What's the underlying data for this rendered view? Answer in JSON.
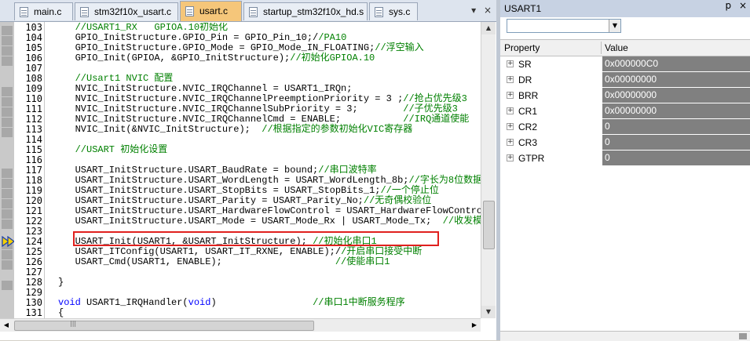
{
  "editor": {
    "tabs": [
      {
        "label": "main.c",
        "active": false
      },
      {
        "label": "stm32f10x_usart.c",
        "active": false
      },
      {
        "label": "usart.c",
        "active": true
      },
      {
        "label": "startup_stm32f10x_hd.s",
        "active": false
      },
      {
        "label": "sys.c",
        "active": false
      }
    ],
    "tab_menu_icon": "▾",
    "tab_close_icon": "×",
    "lines": [
      {
        "no": "103",
        "code": "   //USART1_RX   GPIOA.10初始化",
        "style": "cm"
      },
      {
        "no": "104",
        "code": "   GPIO_InitStructure.GPIO_Pin = GPIO_Pin_10;//PA10",
        "style": "mixed",
        "split": 46
      },
      {
        "no": "105",
        "code": "   GPIO_InitStructure.GPIO_Mode = GPIO_Mode_IN_FLOATING;//浮空输入",
        "style": "mixed",
        "split": 56
      },
      {
        "no": "106",
        "code": "   GPIO_Init(GPIOA, &GPIO_InitStructure);//初始化GPIOA.10",
        "style": "mixed",
        "split": 41
      },
      {
        "no": "107",
        "code": "",
        "style": ""
      },
      {
        "no": "108",
        "code": "   //Usart1 NVIC 配置",
        "style": "cm"
      },
      {
        "no": "109",
        "code": "   NVIC_InitStructure.NVIC_IRQChannel = USART1_IRQn;",
        "style": ""
      },
      {
        "no": "110",
        "code": "   NVIC_InitStructure.NVIC_IRQChannelPreemptionPriority = 3 ;//抢占优先级3",
        "style": "mixed",
        "split": 61
      },
      {
        "no": "111",
        "code": "   NVIC_InitStructure.NVIC_IRQChannelSubPriority = 3;        //子优先级3",
        "style": "mixed",
        "split": 61
      },
      {
        "no": "112",
        "code": "   NVIC_InitStructure.NVIC_IRQChannelCmd = ENABLE;           //IRQ通道使能",
        "style": "mixed",
        "split": 61
      },
      {
        "no": "113",
        "code": "   NVIC_Init(&NVIC_InitStructure);  //根据指定的参数初始化VIC寄存器",
        "style": "mixed",
        "split": 36
      },
      {
        "no": "114",
        "code": "",
        "style": ""
      },
      {
        "no": "115",
        "code": "   //USART 初始化设置",
        "style": "cm"
      },
      {
        "no": "116",
        "code": "",
        "style": ""
      },
      {
        "no": "117",
        "code": "   USART_InitStructure.USART_BaudRate = bound;//串口波特率",
        "style": "mixed",
        "split": 46
      },
      {
        "no": "118",
        "code": "   USART_InitStructure.USART_WordLength = USART_WordLength_8b;//字长为8位数据",
        "style": "mixed",
        "split": 62
      },
      {
        "no": "119",
        "code": "   USART_InitStructure.USART_StopBits = USART_StopBits_1;//一个停止位",
        "style": "mixed",
        "split": 57
      },
      {
        "no": "120",
        "code": "   USART_InitStructure.USART_Parity = USART_Parity_No;//无奇偶校验位",
        "style": "mixed",
        "split": 54
      },
      {
        "no": "121",
        "code": "   USART_InitStructure.USART_HardwareFlowControl = USART_HardwareFlowControl",
        "style": ""
      },
      {
        "no": "122",
        "code": "   USART_InitStructure.USART_Mode = USART_Mode_Rx | USART_Mode_Tx;  //收发模式",
        "style": "mixed",
        "split": 66
      },
      {
        "no": "123",
        "code": "",
        "style": ""
      },
      {
        "no": "124",
        "code": "   USART_Init(USART1, &USART_InitStructure); //初始化串口1",
        "style": "mixed",
        "split": 45
      },
      {
        "no": "125",
        "code": "   USART_ITConfig(USART1, USART_IT_RXNE, ENABLE);//开启串口接受中断",
        "style": "mixed",
        "split": 50
      },
      {
        "no": "126",
        "code": "   USART_Cmd(USART1, ENABLE);                    //使能串口1",
        "style": "mixed",
        "split": 49
      },
      {
        "no": "127",
        "code": "",
        "style": ""
      },
      {
        "no": "128",
        "code": "}",
        "style": ""
      },
      {
        "no": "129",
        "code": "",
        "style": ""
      },
      {
        "no": "130",
        "code": "void USART1_IRQHandler(void)                 //串口1中断服务程序",
        "style": "void",
        "split": 45
      },
      {
        "no": "131",
        "code": "{",
        "style": ""
      }
    ],
    "highlight_color": "#e0201e",
    "scroll_arrows": {
      "up": "▲",
      "down": "▼",
      "left": "◀",
      "right": "▶"
    },
    "hscroll_grip": "|||"
  },
  "watch": {
    "title": "USART1",
    "pin_icon": "p",
    "close_icon": "×",
    "combo_value": "",
    "combo_arrow": "▼",
    "headers": {
      "property": "Property",
      "value": "Value"
    },
    "rows": [
      {
        "name": "SR",
        "value": "0x000000C0"
      },
      {
        "name": "DR",
        "value": "0x00000000"
      },
      {
        "name": "BRR",
        "value": "0x00000000"
      },
      {
        "name": "CR1",
        "value": "0x00000000"
      },
      {
        "name": "CR2",
        "value": "0"
      },
      {
        "name": "CR3",
        "value": "0"
      },
      {
        "name": "GTPR",
        "value": "0"
      }
    ],
    "expand_glyph": "+"
  }
}
